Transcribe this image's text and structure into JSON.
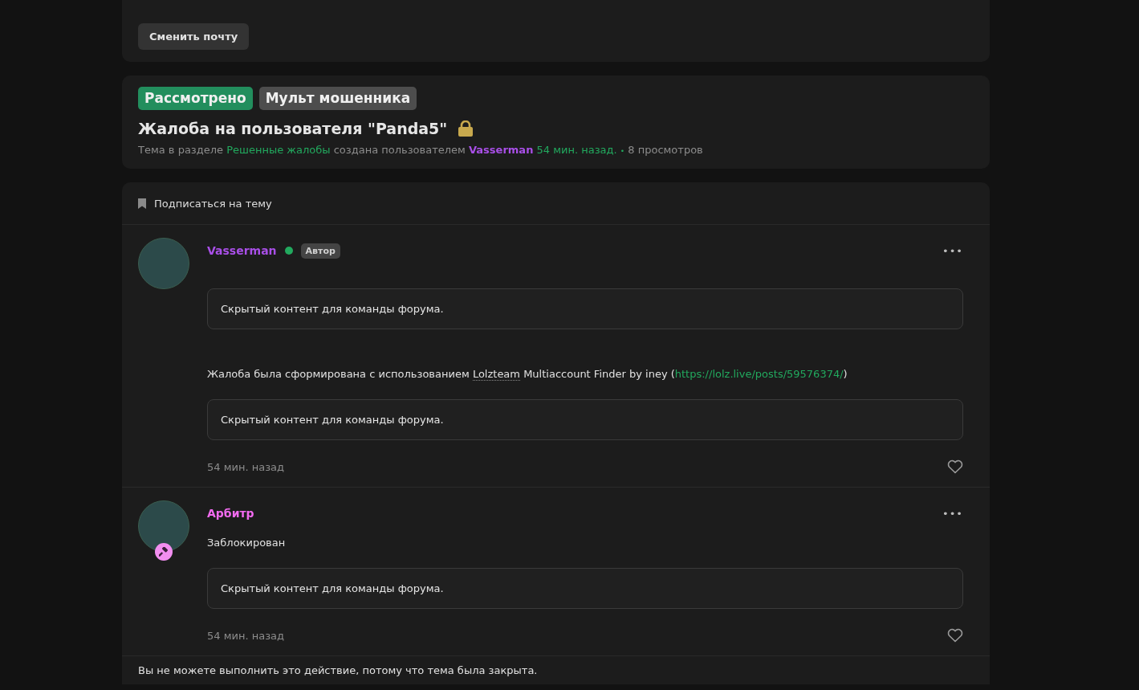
{
  "email_card": {
    "button": "Сменить почту"
  },
  "thread_header": {
    "prefixes": [
      {
        "label": "Рассмотрено",
        "color": "#228e5d"
      },
      {
        "label": "Мульт мошенника",
        "color": "#4d4d4d"
      }
    ],
    "title": "Жалоба на пользователя \"Panda5\"",
    "locked": true,
    "meta": {
      "before": "Тема в разделе",
      "forum": "Решенные жалобы",
      "middle": "создана пользователем",
      "author": "Vasserman",
      "time": "54 мин. назад.",
      "separator": "•",
      "views": "8 просмотров"
    }
  },
  "subscribe": {
    "label": "Подписаться на тему"
  },
  "posts": [
    {
      "author": "Vasserman",
      "color": "#a94fe8",
      "online": true,
      "badge": "Автор",
      "moderator": false,
      "menu": "•••",
      "content": [
        {
          "kind": "hidden",
          "text": "Скрытый контент для команды форума."
        },
        {
          "kind": "text",
          "text": "Жалоба была сформирована с использованием ",
          "term": "Lolzteam",
          "after": " Multiaccount Finder by iney (",
          "link": "https://lolz.live/posts/59576374/",
          "end": ")"
        },
        {
          "kind": "hidden",
          "text": "Скрытый контент для команды форума."
        }
      ],
      "time": "54 мин. назад",
      "liked": false
    },
    {
      "author": "Арбитр",
      "color": "#f26bf0",
      "online": false,
      "moderator": true,
      "menu": "•••",
      "content": [
        {
          "kind": "text",
          "text": "Заблокирован"
        },
        {
          "kind": "hidden",
          "text": "Скрытый контент для команды форума."
        }
      ],
      "time": "54 мин. назад",
      "liked": false
    }
  ],
  "closed_notice": "Вы не можете выполнить это действие, потому что тема была закрыта."
}
